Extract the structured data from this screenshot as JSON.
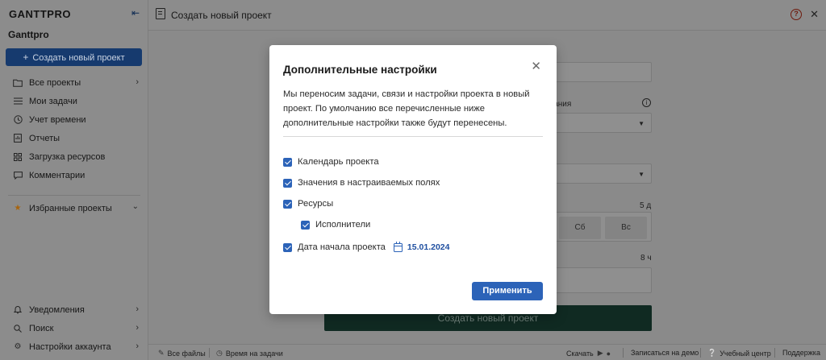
{
  "sidebar": {
    "logo": "GANTTPRO",
    "collapse_icon": "collapse-left-icon",
    "workspace": "Ganttpro",
    "create_label": "Создать новый проект",
    "items": [
      {
        "label": "Все проекты",
        "icon": "folder-icon",
        "chevron": true
      },
      {
        "label": "Мои задачи",
        "icon": "list-icon",
        "chevron": false
      },
      {
        "label": "Учет времени",
        "icon": "clock-icon",
        "chevron": false
      },
      {
        "label": "Отчеты",
        "icon": "report-icon",
        "chevron": false
      },
      {
        "label": "Загрузка ресурсов",
        "icon": "resources-icon",
        "chevron": false
      },
      {
        "label": "Комментарии",
        "icon": "comment-icon",
        "chevron": false
      }
    ],
    "favorites_label": "Избранные проекты",
    "bottom_items": [
      {
        "label": "Уведомления",
        "icon": "bell-icon"
      },
      {
        "label": "Поиск",
        "icon": "search-icon"
      },
      {
        "label": "Настройки аккаунта",
        "icon": "gear-icon"
      }
    ]
  },
  "header": {
    "title": "Создать новый проект"
  },
  "form": {
    "field_label_suffix": "вания",
    "duration_label": "5 д",
    "hours_label": "8 ч",
    "days": [
      "Сб",
      "Вс"
    ],
    "create_button": "Создать новый проект"
  },
  "footer": {
    "all_files": "Все файлы",
    "task_time": "Время на задачи",
    "download": "Скачать",
    "demo": "Записаться на демо",
    "learning": "Учебный центр",
    "support": "Поддержка"
  },
  "modal": {
    "title": "Дополнительные настройки",
    "description": "Мы переносим задачи, связи и настройки проекта в новый проект. По умолчанию все перечисленные ниже дополнительные настройки также будут перенесены.",
    "options": {
      "calendar": "Календарь проекта",
      "custom_fields": "Значения в настраиваемых полях",
      "resources": "Ресурсы",
      "assignees": "Исполнители",
      "start_date": "Дата начала проекта"
    },
    "start_date_value": "15.01.2024",
    "apply_label": "Применить"
  },
  "colors": {
    "accent": "#2c63b8",
    "sidebar_button": "#163a6e",
    "create_project_dark": "#102a22",
    "favorite_star": "#a8640c"
  }
}
